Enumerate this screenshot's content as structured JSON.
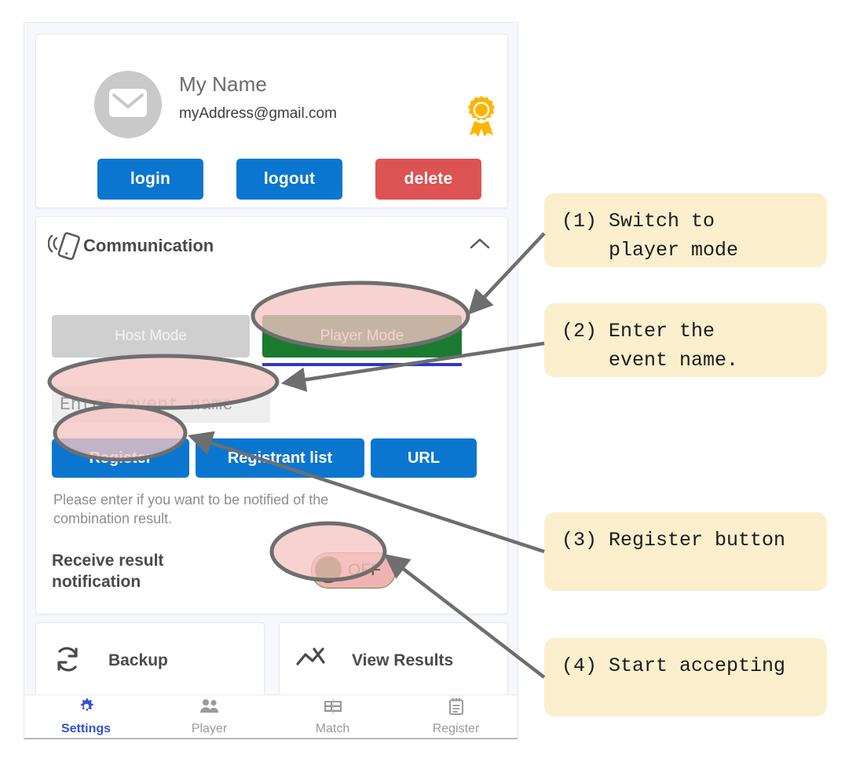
{
  "account": {
    "name": "My Name",
    "email": "myAddress@gmail.com",
    "avatar_icon": "envelope-icon",
    "badge_icon": "award-ribbon-icon",
    "buttons": {
      "login": "login",
      "logout": "logout",
      "delete": "delete"
    }
  },
  "communication": {
    "title": "Communication",
    "icon": "vibrating-phone-icon",
    "collapse_icon": "chevron-up-icon",
    "mode_buttons": {
      "host": "Host Mode",
      "player": "Player Mode",
      "selected": "Player Mode"
    },
    "event_input": {
      "value": "",
      "placeholder": "Enter event name"
    },
    "action_buttons": {
      "register": "Register",
      "registrant_list": "Registrant list",
      "url": "URL"
    },
    "notice": "Please enter if you want to be notified of the combination result.",
    "receive_label": "Receive result notification",
    "toggle": {
      "state": "OFF",
      "label": "OFF"
    }
  },
  "tiles": [
    {
      "label": "Backup",
      "icon": "sync-icon"
    },
    {
      "label": "View Results",
      "icon": "trend-chart-icon"
    }
  ],
  "bottom_nav": [
    {
      "label": "Settings",
      "icon": "gear-icon",
      "active": true
    },
    {
      "label": "Player",
      "icon": "people-icon",
      "active": false
    },
    {
      "label": "Match",
      "icon": "table-grid-icon",
      "active": false
    },
    {
      "label": "Register",
      "icon": "clipboard-icon",
      "active": false
    }
  ],
  "annotations": [
    {
      "id": 1,
      "text": "(1) Switch to\n    player mode"
    },
    {
      "id": 2,
      "text": "(2) Enter the\n    event name."
    },
    {
      "id": 3,
      "text": "(3) Register button"
    },
    {
      "id": 4,
      "text": "(4) Start accepting"
    }
  ],
  "colors": {
    "primary_blue": "#0b76d0",
    "danger_red": "#dd5252",
    "highlight_pink": "#f6c4c4",
    "highlight_outline": "#6e6e6e",
    "callout_bg": "#fcefcd",
    "badge_orange": "#ffb400",
    "player_mode_green": "#1a7a2f",
    "nav_active_blue": "#3550cf"
  }
}
